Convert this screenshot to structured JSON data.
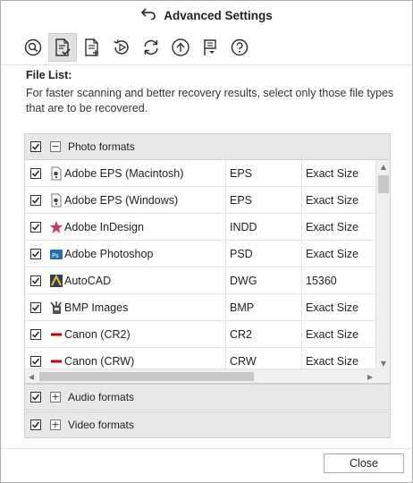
{
  "window": {
    "title": "Advanced Settings"
  },
  "toolbar": {
    "buttons": [
      {
        "name": "search",
        "active": false
      },
      {
        "name": "file-list",
        "active": true
      },
      {
        "name": "file-add",
        "active": false
      },
      {
        "name": "resume-recovery",
        "active": false
      },
      {
        "name": "update",
        "active": false
      },
      {
        "name": "upload",
        "active": false
      },
      {
        "name": "flag",
        "active": false
      },
      {
        "name": "help",
        "active": false
      }
    ]
  },
  "file_list": {
    "heading": "File List:",
    "description": "For faster scanning and better recovery results, select only those file types that are to be recovered."
  },
  "groups": [
    {
      "label": "Photo formats",
      "checked": true,
      "expanded": true,
      "expander": "−"
    },
    {
      "label": "Audio formats",
      "checked": true,
      "expanded": false,
      "expander": "+"
    },
    {
      "label": "Video formats",
      "checked": true,
      "expanded": false,
      "expander": "+"
    }
  ],
  "photo_rows": [
    {
      "name": "Adobe EPS (Macintosh)",
      "ext": "EPS",
      "size": "Exact Size",
      "icon": "eps-icon",
      "checked": true
    },
    {
      "name": "Adobe EPS (Windows)",
      "ext": "EPS",
      "size": "Exact Size",
      "icon": "eps-icon",
      "checked": true
    },
    {
      "name": "Adobe InDesign",
      "ext": "INDD",
      "size": "Exact Size",
      "icon": "indesign-icon",
      "checked": true
    },
    {
      "name": "Adobe Photoshop",
      "ext": "PSD",
      "size": "Exact Size",
      "icon": "photoshop-icon",
      "checked": true
    },
    {
      "name": "AutoCAD",
      "ext": "DWG",
      "size": "15360",
      "icon": "autocad-icon",
      "checked": true
    },
    {
      "name": "BMP Images",
      "ext": "BMP",
      "size": "Exact Size",
      "icon": "bmp-icon",
      "checked": true
    },
    {
      "name": "Canon (CR2)",
      "ext": "CR2",
      "size": "Exact Size",
      "icon": "canon-icon",
      "checked": true
    },
    {
      "name": "Canon (CRW)",
      "ext": "CRW",
      "size": "Exact Size",
      "icon": "canon-icon",
      "checked": true
    }
  ],
  "footer": {
    "close_label": "Close"
  },
  "colors": {
    "group_bg": "#e8e8e8",
    "canon_red": "#cc0000",
    "photoshop_blue": "#1e6fb5",
    "indesign_pink": "#d6336c"
  }
}
